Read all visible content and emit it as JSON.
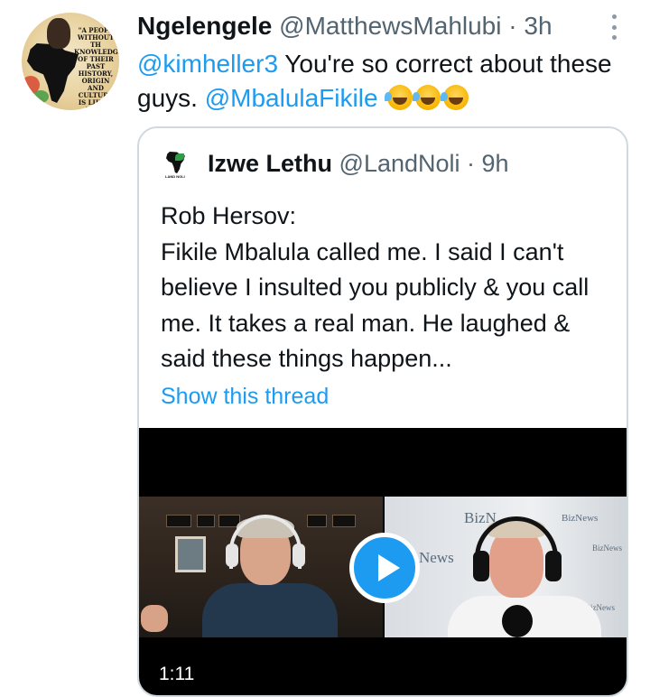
{
  "tweet": {
    "author_name": "Ngelengele",
    "author_handle": "@MatthewsMahlubi",
    "separator": " · ",
    "time": "3h",
    "avatar_text": "\"A PEOPL WITHOUT TH KNOWLEDGE OF THEIR PAST HISTORY, ORIGIN AND CULTURE IS LIKE A TREE WITHOUT ROOTS\"",
    "text": {
      "mention_1": "@kimheller3",
      "body": " You're so correct about these guys. ",
      "mention_2": "@MbalulaFikile",
      "emoji_name": "rolling-on-the-floor-laughing",
      "emoji_count": 3
    }
  },
  "quoted_tweet": {
    "author_name": "Izwe Lethu",
    "author_handle": "@LandNoli",
    "separator": " · ",
    "time": "9h",
    "avatar_label": "LAND NOLI",
    "text": "Rob Hersov:\nFikile Mbalula called me. I said I can't believe I insulted you publicly & you call me. It takes a real man. He laughed & said these things happen...",
    "link_label": "Show this thread",
    "video": {
      "duration": "1:11",
      "background_brand": "BizNews",
      "background_brand_partial": "BizN",
      "background_brand_short": "News"
    }
  },
  "colors": {
    "accent": "#1d9bf0",
    "text_primary": "#0f1419",
    "text_secondary": "#536471",
    "border": "#cfd9de"
  },
  "icons": [
    "more-vertical-icon",
    "play-icon",
    "laughing-emoji-icon"
  ]
}
